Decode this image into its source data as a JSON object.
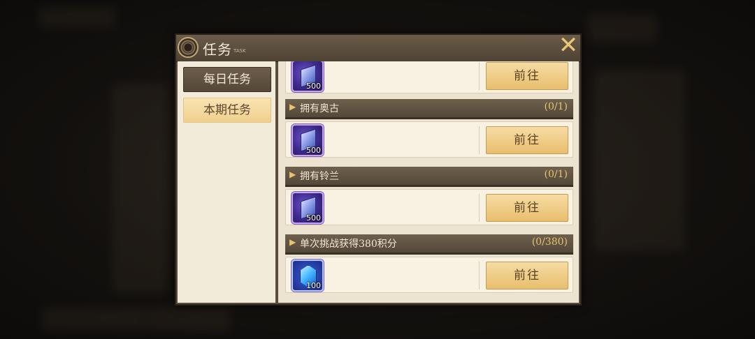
{
  "dialog": {
    "title": "任务",
    "title_sub": "TASK",
    "close_glyph": "✕"
  },
  "sidebar": {
    "items": [
      {
        "label": "每日任务",
        "active": true
      },
      {
        "label": "本期任务",
        "active": false
      }
    ]
  },
  "tasks": [
    {
      "name": "",
      "progress": "",
      "reward_qty": "500",
      "reward_icon": "purple-ingot-icon",
      "button": "前往"
    },
    {
      "name": "拥有奥古",
      "progress": "(0/1)",
      "reward_qty": "500",
      "reward_icon": "purple-ingot-icon",
      "button": "前往"
    },
    {
      "name": "拥有铃兰",
      "progress": "(0/1)",
      "reward_qty": "500",
      "reward_icon": "purple-ingot-icon",
      "button": "前往"
    },
    {
      "name": "单次挑战获得380积分",
      "progress": "(0/380)",
      "reward_qty": "100",
      "reward_icon": "blue-crystal-icon",
      "button": "前往"
    }
  ],
  "arrow_glyph": "▶"
}
